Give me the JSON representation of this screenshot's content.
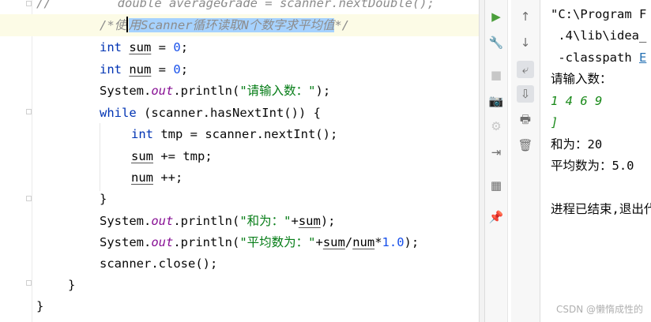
{
  "editor": {
    "lines": {
      "l0": {
        "comment_prefix": "//",
        "text": "double averageGrade = scanner.nextDouble();"
      },
      "l1": {
        "open": "/*使",
        "selected": "用Scanner循环读取N个数字求平均值",
        "close": "*/"
      },
      "l2": {
        "kw": "int",
        "var": "sum",
        "op": " = ",
        "num": "0",
        "end": ";"
      },
      "l3": {
        "kw": "int",
        "var": "num",
        "op": " = ",
        "num": "0",
        "end": ";"
      },
      "l4": {
        "pre": "System.",
        "fld": "out",
        "mid": ".println(",
        "str": "\"请输入数：\"",
        "end": ");"
      },
      "l5": {
        "kw": "while",
        "rest": " (scanner.hasNextInt()) {"
      },
      "l6": {
        "kw": "int",
        "rest": " tmp = scanner.nextInt();"
      },
      "l7": {
        "var": "sum",
        "rest": " += tmp;"
      },
      "l8": {
        "var": "num",
        "rest": " ++;"
      },
      "l9": {
        "text": "}"
      },
      "l10": {
        "pre": "System.",
        "fld": "out",
        "mid": ".println(",
        "str": "\"和为：\"",
        "plus": "+",
        "var": "sum",
        "end": ");"
      },
      "l11": {
        "pre": "System.",
        "fld": "out",
        "mid": ".println(",
        "str": "\"平均数为：\"",
        "plus": "+",
        "var1": "sum",
        "slash": "/",
        "var2": "num",
        "star": "*",
        "num": "1.0",
        "end": ");"
      },
      "l12": {
        "text": "scanner.close();"
      },
      "l13": {
        "text": "}"
      },
      "l14": {
        "text": "}"
      }
    }
  },
  "toolbar_left": {
    "run": "▶",
    "wrench": "🔧",
    "stop": "■",
    "camera": "📷",
    "debug": "⚙",
    "exit": "⇥",
    "layout": "▦",
    "pin": "📌"
  },
  "toolbar_right": {
    "up": "↑",
    "down": "↓",
    "wrap": "⤶",
    "scroll_end": "⇩",
    "print": "🖶",
    "trash": "🗑"
  },
  "console": {
    "c0": "\"C:\\Program F",
    "c1": " .4\\lib\\idea_",
    "c2_pre": " -classpath ",
    "c2_link": "E",
    "c3": "请输入数：",
    "c4": "1 4 6 9",
    "c5": "]",
    "c6": "和为：20",
    "c7": "平均数为：5.0",
    "c8": "进程已结束,退出代"
  },
  "watermark": "CSDN @懒惰成性的"
}
